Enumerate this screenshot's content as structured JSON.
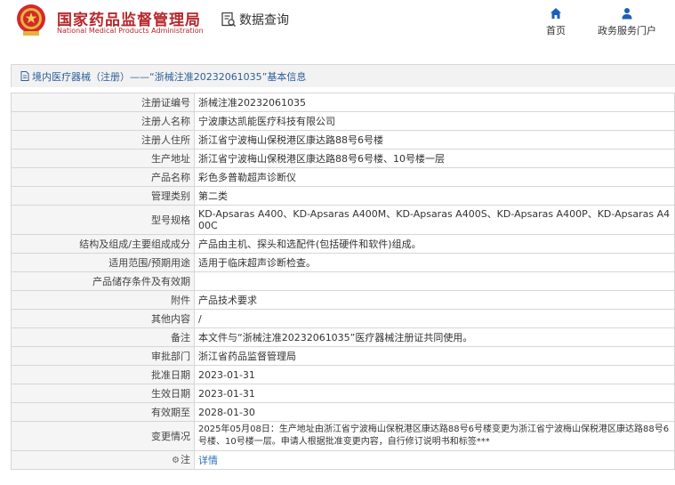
{
  "header": {
    "site_name": "国家药品监督管理局",
    "site_name_en": "National Medical Products Administration",
    "query_label": "数据查询",
    "nav": [
      {
        "label": "首页",
        "icon": "home-icon"
      },
      {
        "label": "政务服务门户",
        "icon": "user-icon"
      }
    ]
  },
  "title_bar": {
    "icon": "document-icon",
    "text": "境内医疗器械（注册）——“浙械注准20232061035”基本信息"
  },
  "rows": [
    {
      "label": "注册证编号",
      "value": "浙械注准20232061035"
    },
    {
      "label": "注册人名称",
      "value": "宁波康达凯能医疗科技有限公司"
    },
    {
      "label": "注册人住所",
      "value": "浙江省宁波梅山保税港区康达路88号6号楼"
    },
    {
      "label": "生产地址",
      "value": "浙江省宁波梅山保税港区康达路88号6号楼、10号楼一层"
    },
    {
      "label": "产品名称",
      "value": "彩色多普勒超声诊断仪"
    },
    {
      "label": "管理类别",
      "value": "第二类"
    },
    {
      "label": "型号规格",
      "value": "KD-Apsaras A400、KD-Apsaras A400M、KD-Apsaras A400S、KD-Apsaras A400P、KD-Apsaras A400C"
    },
    {
      "label": "结构及组成/主要组成成分",
      "value": "产品由主机、探头和选配件(包括硬件和软件)组成。"
    },
    {
      "label": "适用范围/预期用途",
      "value": "适用于临床超声诊断检查。"
    },
    {
      "label": "产品储存条件及有效期",
      "value": ""
    },
    {
      "label": "附件",
      "value": "产品技术要求"
    },
    {
      "label": "其他内容",
      "value": "/"
    },
    {
      "label": "备注",
      "value": "本文件与“浙械注准20232061035”医疗器械注册证共同使用。"
    },
    {
      "label": "审批部门",
      "value": "浙江省药品监督管理局"
    },
    {
      "label": "批准日期",
      "value": "2023-01-31"
    },
    {
      "label": "生效日期",
      "value": "2023-01-31"
    },
    {
      "label": "有效期至",
      "value": "2028-01-30"
    },
    {
      "label": "变更情况",
      "value": "2025年05月08日：生产地址由浙江省宁波梅山保税港区康达路88号6号楼变更为浙江省宁波梅山保税港区康达路88号6号楼、10号楼一层。申请人根据批准变更内容，自行修订说明书和标签***"
    }
  ],
  "note_row": {
    "label": "注",
    "icon": "gear-icon",
    "link_text": "详情"
  },
  "colors": {
    "brand": "#b5282d",
    "link": "#2c6fbb",
    "title": "#2c5f9b",
    "nav_icon": "#1d5fb8"
  }
}
